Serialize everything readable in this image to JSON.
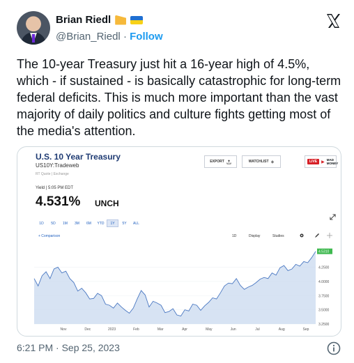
{
  "tweet": {
    "author_name": "Brian Riedl",
    "handle": "@Brian_Riedl",
    "separator": " · ",
    "follow_label": "Follow",
    "text": "The 10-year Treasury just hit a 16-year high of 4.5%, which - if sustained - is basically catastrophic for long-term federal deficits. This is much more important than the vast majority of daily politics and culture fights getting most of the media's attention.",
    "timestamp": "6:21 PM · Sep 25, 2023",
    "badges": [
      "cheese-emoji",
      "ukraine-flag-emoji"
    ]
  },
  "cnbc": {
    "title": "U.S. 10 Year Treasury",
    "symbol": "US10Y:Tradeweb",
    "rt_quote": "RT Quote | Exchange",
    "export_label": "EXPORT",
    "watchlist_label": "WATCHLIST",
    "live_label": "LIVE",
    "mad_money_label": "MAD MONEY",
    "yield_label": "Yield | 5:05 PM EDT",
    "yield_value": "4.531%",
    "change": "UNCH",
    "ranges": [
      "1D",
      "5D",
      "1M",
      "3M",
      "6M",
      "YTD",
      "1Y",
      "5Y",
      "ALL"
    ],
    "active_range": "1Y",
    "toolbar": {
      "comparison": "+ Comparison",
      "interval": "1D",
      "display": "Display",
      "studies": "Studies"
    }
  },
  "chart_data": {
    "type": "area",
    "xlabel": "",
    "ylabel": "",
    "x_ticks": [
      "Nov",
      "Dec",
      "2023",
      "Feb",
      "Mar",
      "Apr",
      "May",
      "Jun",
      "Jul",
      "Aug",
      "Sep"
    ],
    "y_ticks": [
      "4.2500",
      "4.0000",
      "3.7500",
      "3.5000",
      "3.2500"
    ],
    "ylim": [
      3.25,
      4.6
    ],
    "last_value_label": "4.5310",
    "series": [
      {
        "values": [
          4.05,
          3.92,
          4.1,
          4.17,
          4.05,
          4.22,
          4.25,
          4.15,
          4.18,
          4.05,
          3.98,
          3.83,
          3.88,
          3.8,
          3.69,
          3.7,
          3.79,
          3.75,
          3.6,
          3.58,
          3.53,
          3.62,
          3.55,
          3.49,
          3.44,
          3.53,
          3.69,
          3.84,
          3.76,
          3.55,
          3.65,
          3.62,
          3.58,
          3.45,
          3.47,
          3.52,
          3.41,
          3.39,
          3.5,
          3.48,
          3.6,
          3.58,
          3.49,
          3.57,
          3.63,
          3.71,
          3.69,
          3.8,
          3.92,
          3.97,
          3.96,
          4.05,
          3.93,
          3.86,
          3.9,
          3.93,
          3.98,
          4.04,
          4.07,
          4.05,
          4.15,
          4.11,
          4.24,
          4.28,
          4.19,
          4.22,
          4.3,
          4.27,
          4.35,
          4.33,
          4.42,
          4.53
        ]
      }
    ]
  },
  "colors": {
    "link": "#1d9bf0",
    "muted": "#536471",
    "chart_line": "#4a78c2",
    "chart_fill": "#c9d9ef",
    "last_badge": "#3fb950",
    "live_red": "#d62027"
  }
}
